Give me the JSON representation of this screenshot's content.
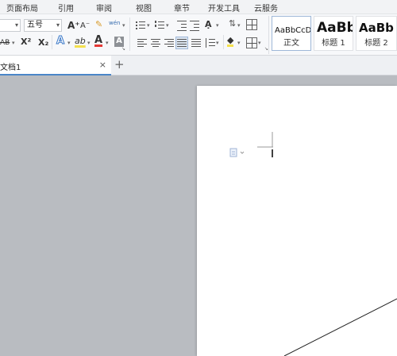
{
  "menu": {
    "items": [
      "页面布局",
      "引用",
      "审阅",
      "视图",
      "章节",
      "开发工具",
      "云服务"
    ]
  },
  "ribbon": {
    "font_size_value": "五号",
    "strikethrough_label": "AB",
    "superscript_label": "X²",
    "subscript_label": "X₂",
    "text_effect_label": "A",
    "highlight_label": "ab",
    "font_color_label": "A",
    "char_shading_label": "A",
    "grow_font_label": "A⁺",
    "shrink_font_label": "A⁻",
    "phonetic_label": "wén",
    "font_color_hex": "#e53935",
    "highlight_hex": "#f4e04d"
  },
  "styles": [
    {
      "preview": "AaBbCcDd",
      "name": "正文"
    },
    {
      "preview": "AaBb",
      "name": "标题 1"
    },
    {
      "preview": "AaBb",
      "name": "标题 2"
    }
  ],
  "tabs": {
    "doc_title": "文档1",
    "close": "×",
    "new_tab": "+"
  },
  "colors": {
    "accent": "#4a86c8",
    "workspace": "#b9bcc1"
  }
}
